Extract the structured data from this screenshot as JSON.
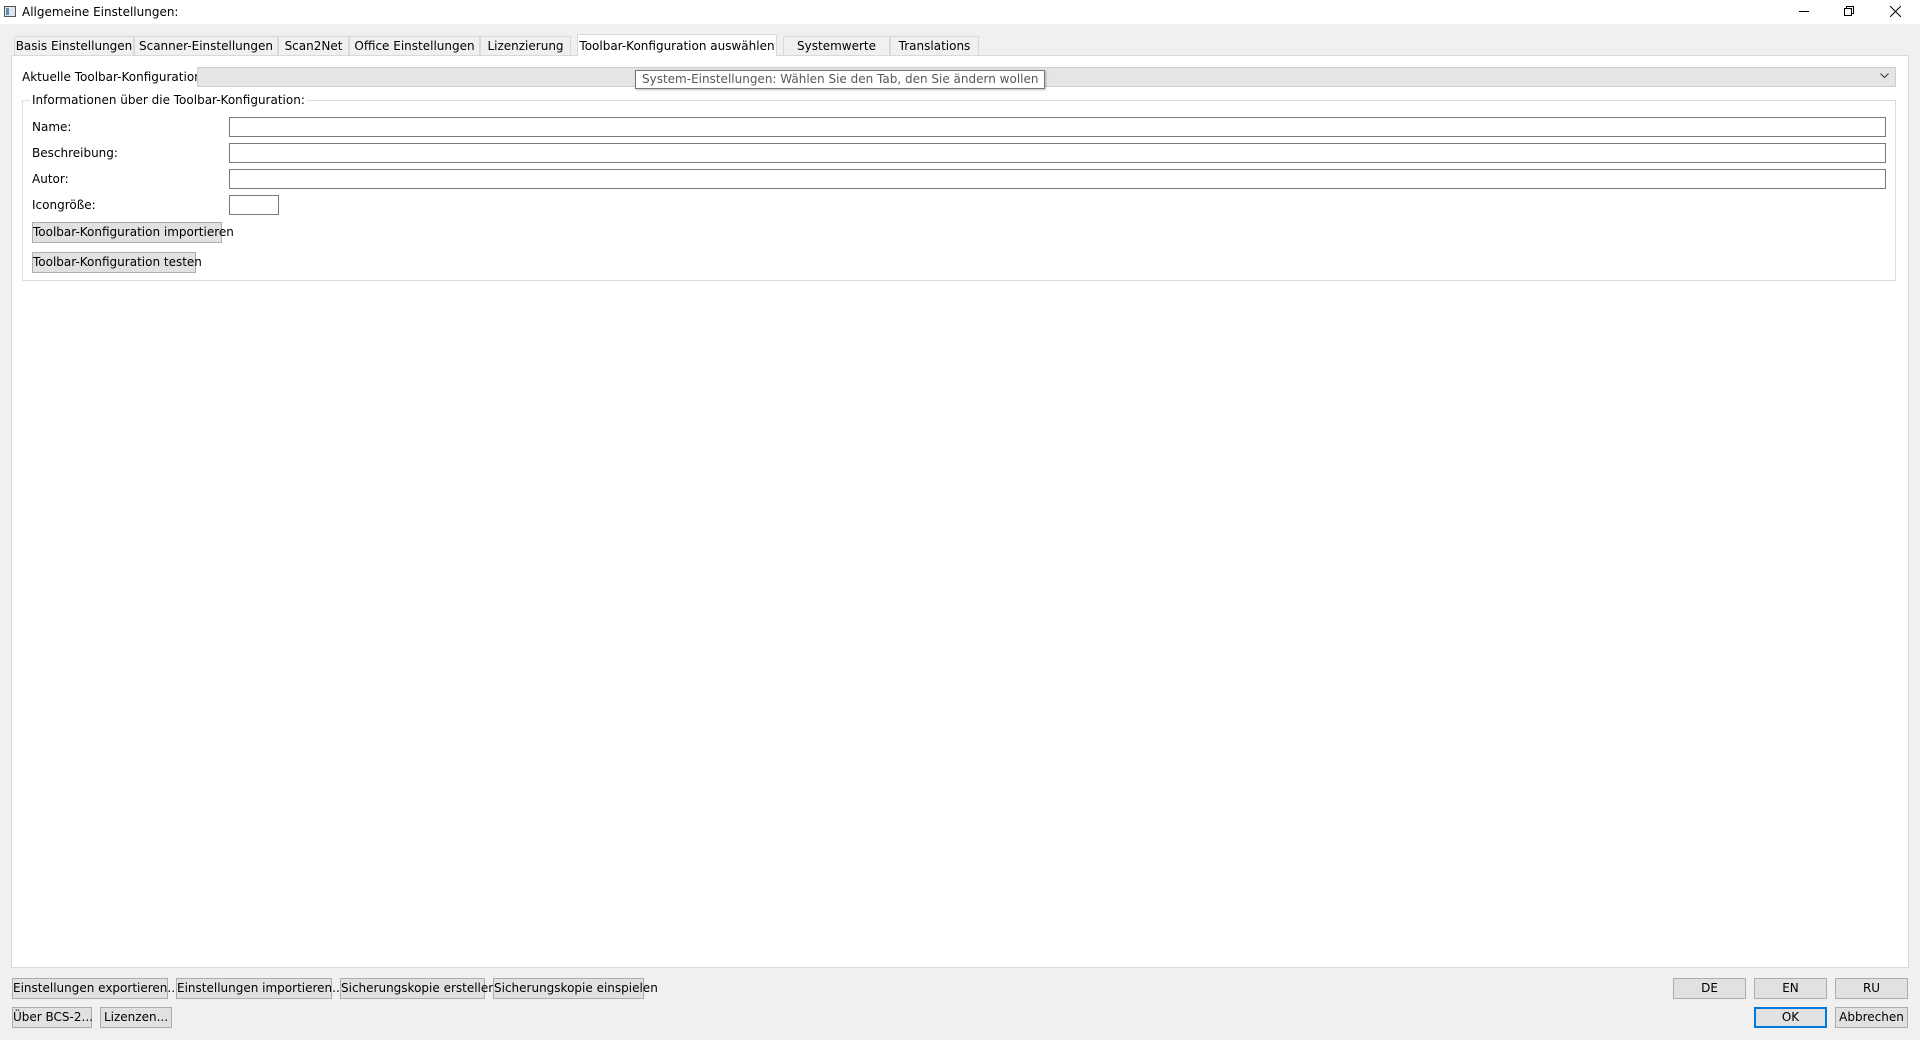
{
  "window": {
    "title": "Allgemeine Einstellungen:",
    "controls": {
      "minimize": "minimize",
      "restore": "restore",
      "close": "close"
    }
  },
  "tabs": [
    {
      "label": "Basis Einstellungen",
      "active": false
    },
    {
      "label": "Scanner-Einstellungen",
      "active": false
    },
    {
      "label": "Scan2Net",
      "active": false
    },
    {
      "label": "Office Einstellungen",
      "active": false
    },
    {
      "label": "Lizenzierung",
      "active": false
    },
    {
      "label": "Toolbar-Konfiguration auswählen",
      "active": true
    },
    {
      "label": "Systemwerte",
      "active": false
    },
    {
      "label": "Translations",
      "active": false
    }
  ],
  "toolbar_config": {
    "current_label": "Aktuelle Toolbar-Konfiguration:",
    "current_value": "",
    "tooltip": "System-Einstellungen: Wählen Sie den Tab, den Sie ändern wollen",
    "group_title": "Informationen über die Toolbar-Konfiguration:",
    "fields": {
      "name_label": "Name:",
      "name_value": "",
      "description_label": "Beschreibung:",
      "description_value": "",
      "author_label": "Autor:",
      "author_value": "",
      "iconsize_label": "Icongröße:",
      "iconsize_value": ""
    },
    "import_button": "Toolbar-Konfiguration importieren",
    "test_button": "Toolbar-Konfiguration testen"
  },
  "footer": {
    "export_settings": "Einstellungen exportieren...",
    "import_settings": "Einstellungen importieren...",
    "create_backup": "Sicherungskopie erstellen",
    "restore_backup": "Sicherungskopie einspielen",
    "about": "Über BCS-2...",
    "licenses": "Lizenzen...",
    "lang_de": "DE",
    "lang_en": "EN",
    "lang_ru": "RU",
    "ok": "OK",
    "cancel": "Abbrechen"
  }
}
